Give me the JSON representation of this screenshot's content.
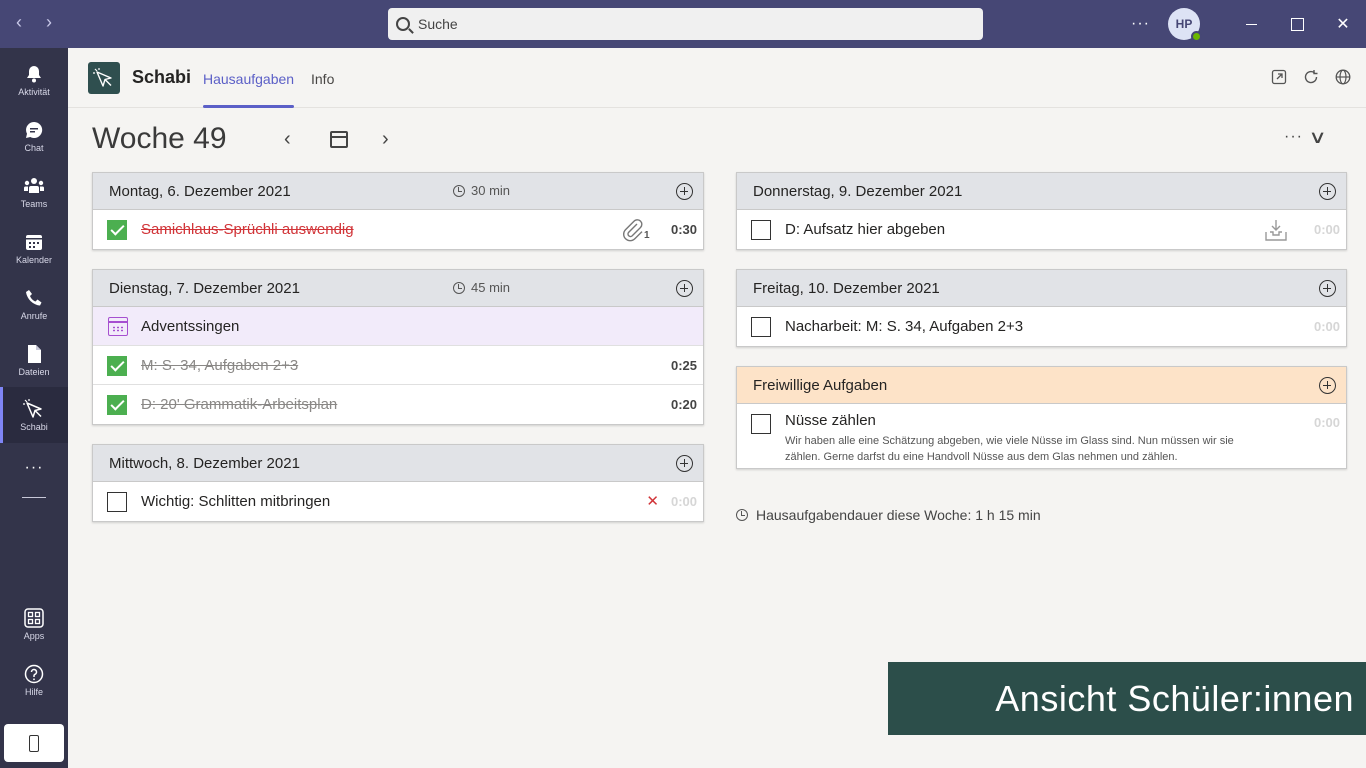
{
  "titlebar": {
    "search_placeholder": "Suche",
    "avatar_initials": "HP"
  },
  "rail": {
    "items": [
      {
        "label": "Aktivität",
        "icon": "bell-icon"
      },
      {
        "label": "Chat",
        "icon": "chat-icon"
      },
      {
        "label": "Teams",
        "icon": "teams-icon"
      },
      {
        "label": "Kalender",
        "icon": "calendar-icon"
      },
      {
        "label": "Anrufe",
        "icon": "phone-icon"
      },
      {
        "label": "Dateien",
        "icon": "file-icon"
      },
      {
        "label": "Schabi",
        "icon": "schabi-icon"
      },
      {
        "label": "Apps",
        "icon": "apps-icon"
      },
      {
        "label": "Hilfe",
        "icon": "help-icon"
      }
    ]
  },
  "app": {
    "name": "Schabi",
    "tabs": [
      "Hausaufgaben",
      "Info"
    ],
    "active_tab": "Hausaufgaben"
  },
  "week": {
    "title": "Woche 49"
  },
  "days": {
    "monday": {
      "title": "Montag, 6. Dezember 2021",
      "duration": "30 min",
      "tasks": [
        {
          "text": "Samichlaus-Sprüchli auswendig",
          "done": true,
          "time": "0:30",
          "attachments": "1"
        }
      ]
    },
    "tuesday": {
      "title": "Dienstag, 7. Dezember 2021",
      "duration": "45 min",
      "event": "Adventssingen",
      "tasks": [
        {
          "text": "M: S. 34, Aufgaben 2+3",
          "done": true,
          "time": "0:25"
        },
        {
          "text": "D: 20' Grammatik-Arbeitsplan",
          "done": true,
          "time": "0:20"
        }
      ]
    },
    "wednesday": {
      "title": "Mittwoch, 8. Dezember 2021",
      "tasks": [
        {
          "text": "Wichtig: Schlitten mitbringen",
          "done": false,
          "time": "0:00"
        }
      ]
    },
    "thursday": {
      "title": "Donnerstag, 9. Dezember 2021",
      "tasks": [
        {
          "text": "D: Aufsatz hier abgeben",
          "done": false,
          "time": "0:00"
        }
      ]
    },
    "friday": {
      "title": "Freitag, 10. Dezember 2021",
      "tasks": [
        {
          "text": "Nacharbeit: M: S. 34, Aufgaben 2+3",
          "done": false,
          "time": "0:00"
        }
      ]
    },
    "optional": {
      "title": "Freiwillige Aufgaben",
      "tasks": [
        {
          "text": "Nüsse zählen",
          "done": false,
          "time": "0:00",
          "description_line1": "Wir haben alle eine Schätzung abgeben, wie viele Nüsse im Glass sind. Nun müssen wir sie",
          "description_line2": "zählen. Gerne darfst du eine Handvoll Nüsse aus dem Glas nehmen und zählen."
        }
      ]
    }
  },
  "summary": {
    "total": "Hausaufgabendauer diese Woche: 1 h 15 min"
  },
  "banner": {
    "text": "Ansicht Schüler:innen"
  },
  "colors": {
    "titlebar": "#464775",
    "rail": "#33344a",
    "accent": "#5b5fc7",
    "done_green": "#4caf50",
    "strike_red": "#d13438",
    "optional_header": "#fde3c8",
    "event_bg": "#f2ebfa",
    "banner_bg": "#2c4e4a"
  }
}
